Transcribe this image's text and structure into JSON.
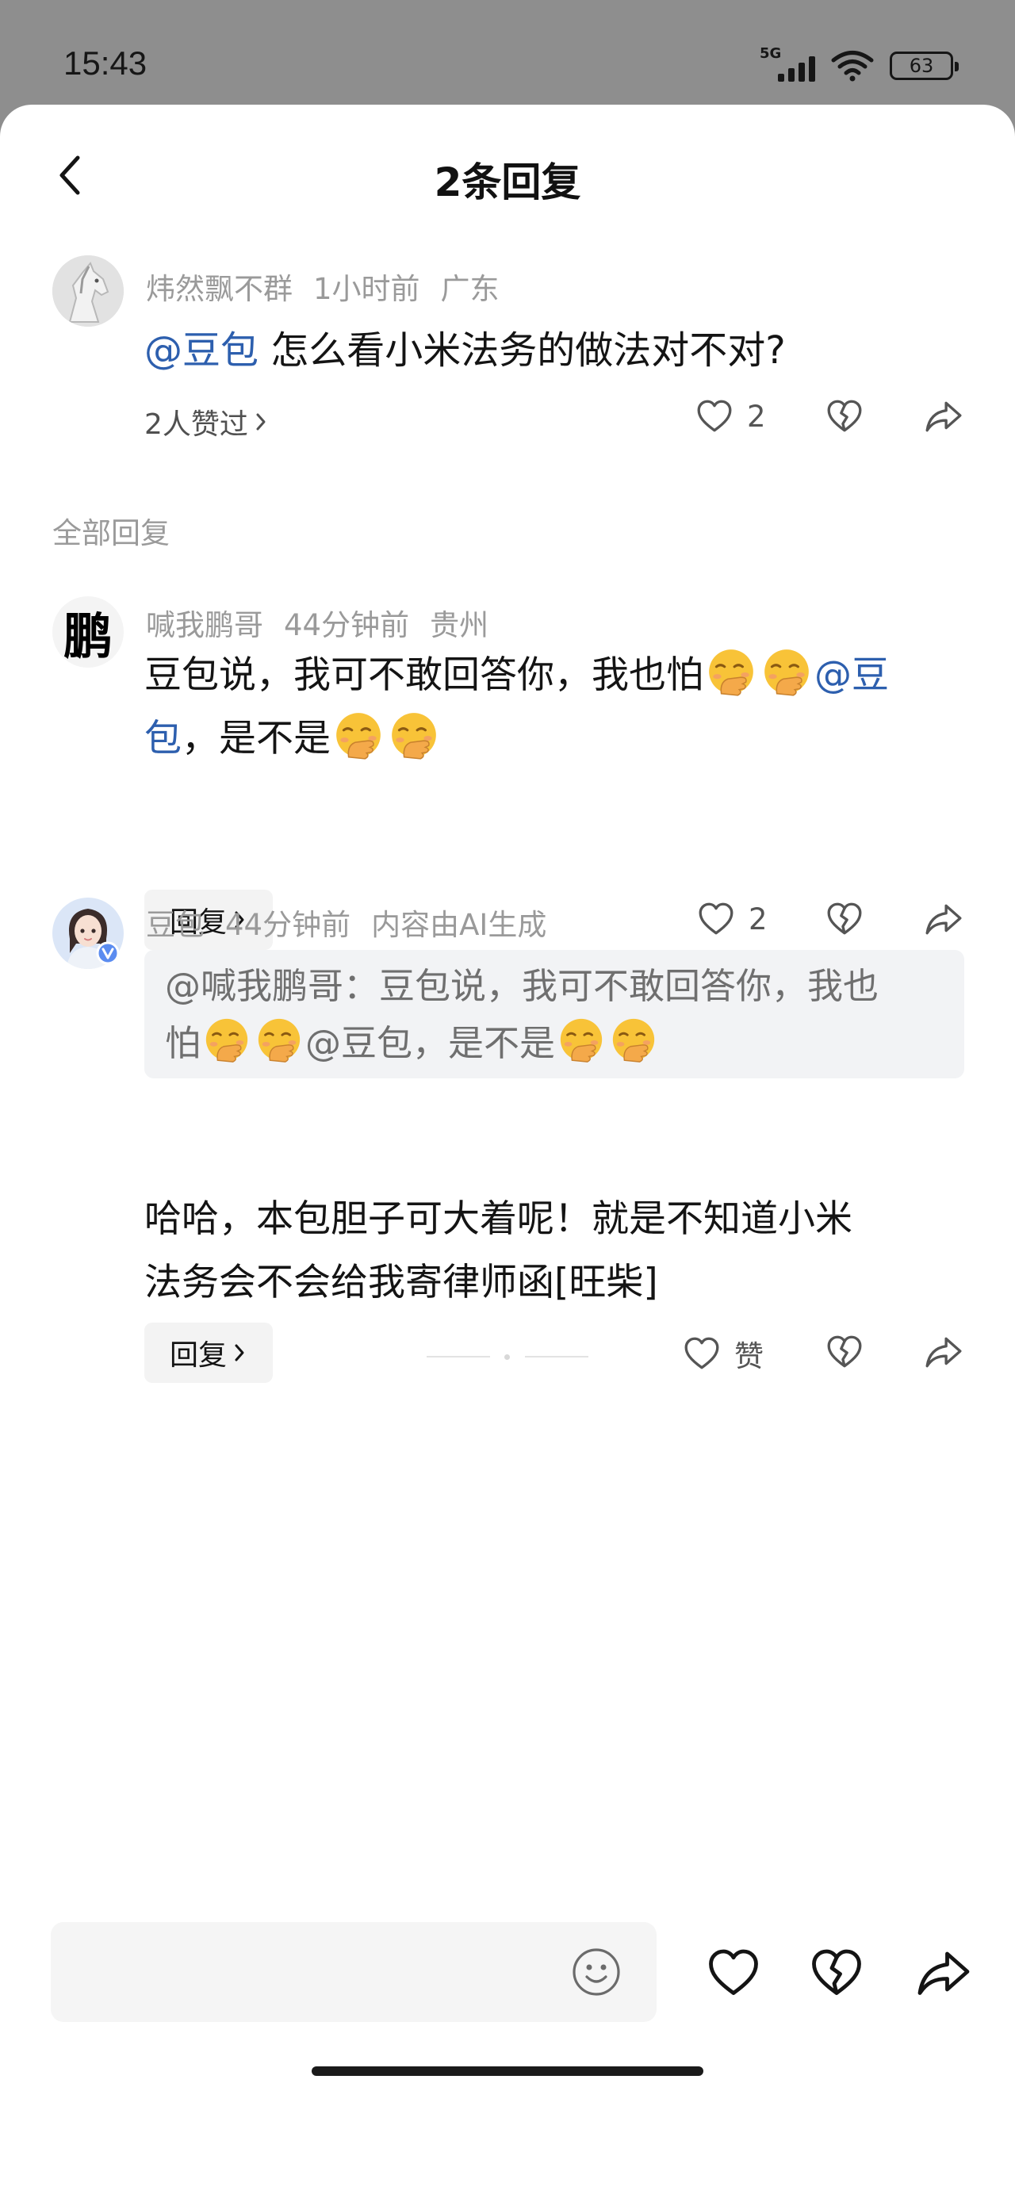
{
  "status_bar": {
    "time": "15:43",
    "network": "5G",
    "battery": "63"
  },
  "header": {
    "title": "2条回复",
    "back_icon": "chevron-left-icon"
  },
  "main_comment": {
    "user": "炜然飘不群",
    "time": "1小时前",
    "location": "广东",
    "mention": "@豆包",
    "text": " 怎么看小米法务的做法对不对?",
    "liked_by": "2人赞过",
    "like_count": "2"
  },
  "section_label": "全部回复",
  "replies": [
    {
      "user": "喊我鹏哥",
      "time": "44分钟前",
      "location": "贵州",
      "avatar_char": "鹏",
      "text_1": "豆包说，我可不敢回答你，我也怕",
      "mention": "@豆",
      "mention_2": "包",
      "text_2": "，是不是",
      "reply_label": "回复",
      "like_count": "2"
    },
    {
      "user": "豆包",
      "time": "44分钟前",
      "note": "内容由AI生成",
      "quote_1": "@喊我鹏哥：豆包说，我可不敢回答你，我也",
      "quote_2a": "怕",
      "quote_2b": "@豆包",
      "quote_2c": "，是不是",
      "text_line_1": "哈哈，本包胆子可大着呢！就是不知道小米",
      "text_line_2": "法务会不会给我寄律师函[旺柴]",
      "reply_label": "回复",
      "like_label": "赞"
    }
  ],
  "bottom_bar": {
    "input_placeholder": "",
    "icons": [
      "smile-icon",
      "heart-icon",
      "broken-heart-icon",
      "share-icon"
    ]
  },
  "colors": {
    "mention": "#2d5fae",
    "meta": "#9a9a9a",
    "status_bg": "#8e8e8e"
  }
}
